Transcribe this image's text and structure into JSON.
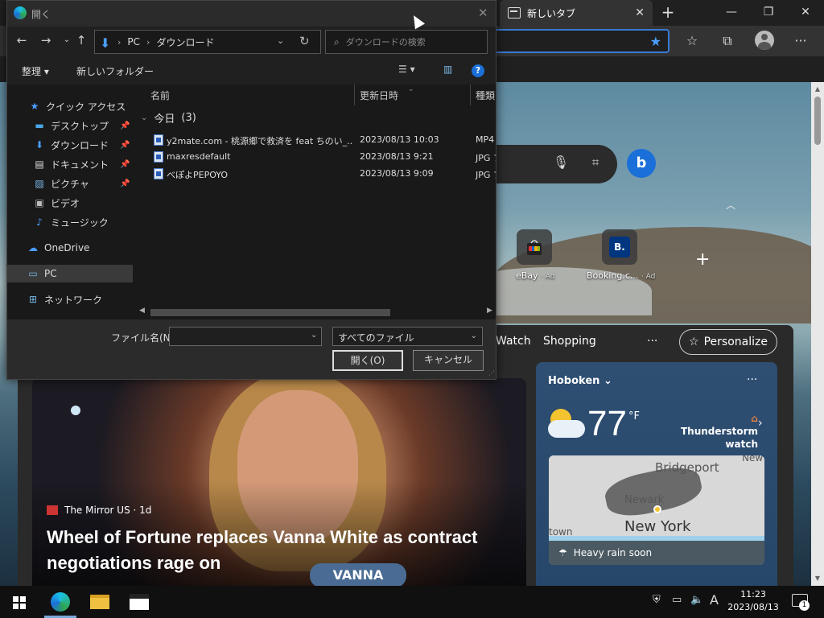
{
  "browser": {
    "tab": {
      "title": "新しいタブ",
      "close": "✕"
    },
    "newtab": "+",
    "window_controls": {
      "minimize": "—",
      "restore": "❐",
      "close": "✕"
    },
    "toolbar_icons": [
      "star-icon",
      "favorites-icon",
      "collections-icon",
      "profile-icon",
      "more-icon"
    ],
    "more": "···"
  },
  "newtab_page": {
    "quick_links": [
      {
        "label": "eBay",
        "ad": "· Ad",
        "icon": "ebay-bag-icon"
      },
      {
        "label": "Booking.c...",
        "ad": "· Ad",
        "icon": "booking-icon",
        "glyph": "B."
      }
    ],
    "feed_nav": {
      "watch": "Watch",
      "shopping": "Shopping",
      "more": "···",
      "personalize": "Personalize"
    },
    "hero": {
      "source": "The Mirror US · 1d",
      "headline": "Wheel of Fortune replaces Vanna White as contract negotiations rage on",
      "name_tag": "VANNA"
    },
    "weather": {
      "city": "Hoboken",
      "temp": "77",
      "unit": "°F",
      "alert": "Thunderstorm watch",
      "map_labels": [
        "Bridgeport",
        "Newark",
        "New York",
        "town",
        "New"
      ],
      "rain": "Heavy rain soon"
    }
  },
  "dialog": {
    "title": "開く",
    "path": {
      "root": "PC",
      "folder": "ダウンロード"
    },
    "search_placeholder": "ダウンロードの検索",
    "commands": {
      "organize": "整理 ▾",
      "new_folder": "新しいフォルダー"
    },
    "nav_items": [
      {
        "label": "クイック アクセス",
        "icon": "star-icon",
        "glyph": "★",
        "color": "#4a9eff"
      },
      {
        "label": "デスクトップ",
        "icon": "desktop-icon",
        "glyph": "▬",
        "color": "#4aa8e8",
        "pinned": true
      },
      {
        "label": "ダウンロード",
        "icon": "download-icon",
        "glyph": "⬇",
        "color": "#4a9eff",
        "pinned": true
      },
      {
        "label": "ドキュメント",
        "icon": "document-icon",
        "glyph": "▤",
        "color": "#ddd",
        "pinned": true
      },
      {
        "label": "ピクチャ",
        "icon": "pictures-icon",
        "glyph": "▨",
        "color": "#7ab8e8",
        "pinned": true
      },
      {
        "label": "ビデオ",
        "icon": "video-icon",
        "glyph": "▣",
        "color": "#bbb"
      },
      {
        "label": "ミュージック",
        "icon": "music-icon",
        "glyph": "♪",
        "color": "#4a9eff"
      },
      {
        "label": "OneDrive",
        "icon": "onedrive-icon",
        "glyph": "☁",
        "color": "#4a9eff"
      },
      {
        "label": "PC",
        "icon": "pc-icon",
        "glyph": "▭",
        "color": "#7ab8e8"
      },
      {
        "label": "ネットワーク",
        "icon": "network-icon",
        "glyph": "⊞",
        "color": "#7ab8e8"
      }
    ],
    "columns": {
      "name": "名前",
      "date": "更新日時",
      "type": "種類"
    },
    "group": {
      "label": "今日",
      "count": "(3)"
    },
    "files": [
      {
        "name": "y2mate.com - 桃源郷で救済を feat ちのい_...",
        "date": "2023/08/13 10:03",
        "type": "MP4"
      },
      {
        "name": "maxresdefault",
        "date": "2023/08/13 9:21",
        "type": "JPG フ"
      },
      {
        "name": "べぽよPEPOYO",
        "date": "2023/08/13 9:09",
        "type": "JPG フ"
      }
    ],
    "filename_label": "ファイル名(N):",
    "filename_value": "",
    "filter": "すべてのファイル",
    "open_button": "開く(O)",
    "cancel_button": "キャンセル"
  },
  "taskbar": {
    "clock": {
      "time": "11:23",
      "date": "2023/08/13"
    },
    "ime": "A",
    "notification_count": "1"
  }
}
